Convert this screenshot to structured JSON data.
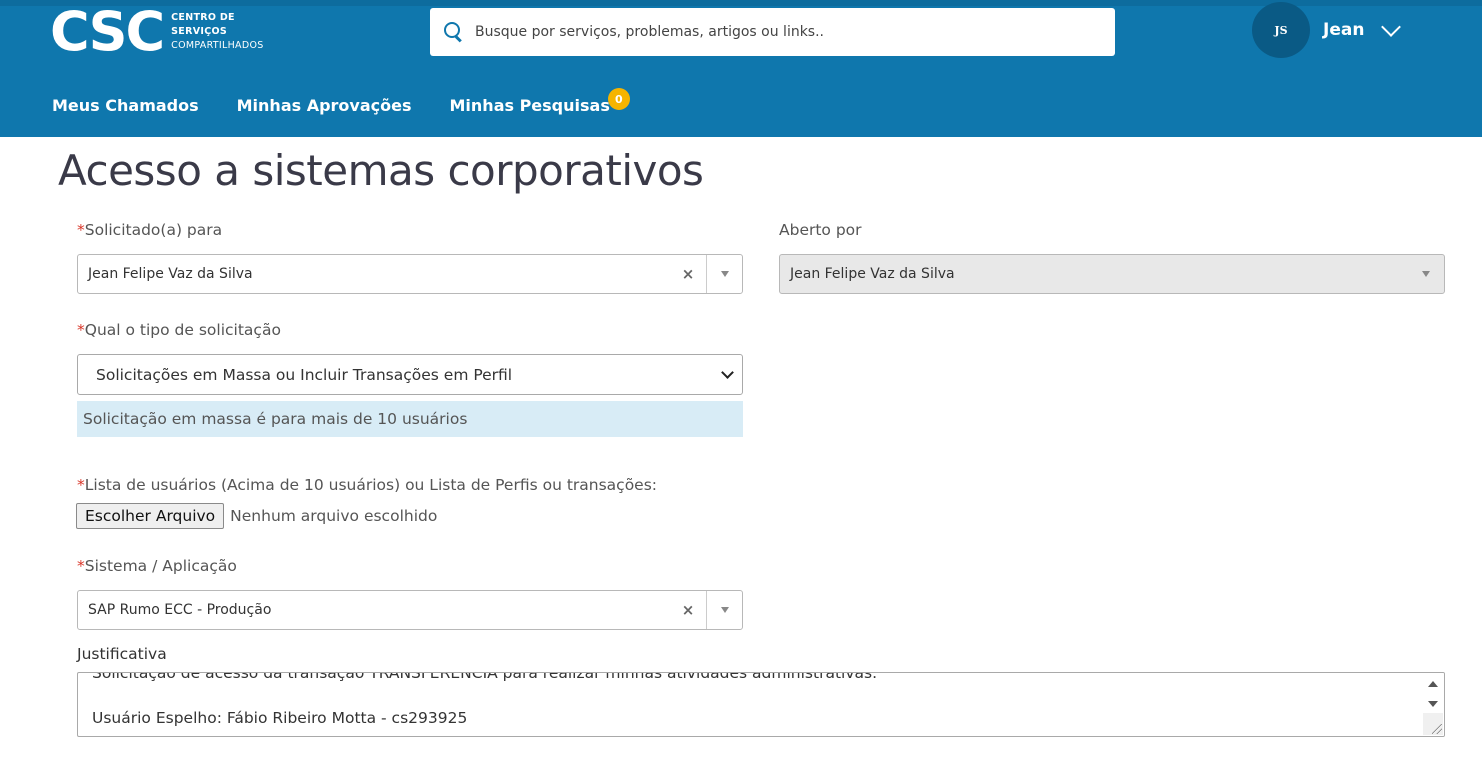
{
  "header": {
    "logo_main": "CSC",
    "logo_line1": "CENTRO DE",
    "logo_line2": "SERVIÇOS",
    "logo_line3": "COMPARTILHADOS",
    "search_placeholder": "Busque por serviços, problemas, artigos ou links..",
    "avatar_initials": "JS",
    "user_name": "Jean",
    "nav": [
      {
        "label": "Meus Chamados"
      },
      {
        "label": "Minhas Aprovações"
      },
      {
        "label": "Minhas Pesquisas",
        "badge": "0"
      }
    ],
    "colors": {
      "primary": "#0f77ad",
      "badge": "#f5b400"
    }
  },
  "form": {
    "title": "Acesso a sistemas corporativos",
    "requested_for": {
      "label": "Solicitado(a) para",
      "value": "Jean Felipe Vaz da Silva"
    },
    "opened_by": {
      "label": "Aberto por",
      "value": "Jean Felipe Vaz da Silva"
    },
    "request_type": {
      "label": "Qual o tipo de solicitação",
      "value": "Solicitações em Massa ou Incluir Transações em Perfil"
    },
    "info": "Solicitação em massa é para mais de 10 usuários",
    "file": {
      "label": "Lista de usuários (Acima de 10 usuários) ou Lista de Perfis ou transações:",
      "button": "Escolher Arquivo",
      "status": "Nenhum arquivo escolhido"
    },
    "system": {
      "label": "Sistema / Aplicação",
      "value": "SAP Rumo ECC - Produção"
    },
    "justification": {
      "label": "Justificativa",
      "line1": "Solicitação de acesso da transação TRANSFERENCIA para realizar minhas atividades administrativas.",
      "line2": "Usuário Espelho: Fábio Ribeiro Motta - cs293925"
    },
    "required_mark": "*",
    "clear_symbol": "×"
  }
}
